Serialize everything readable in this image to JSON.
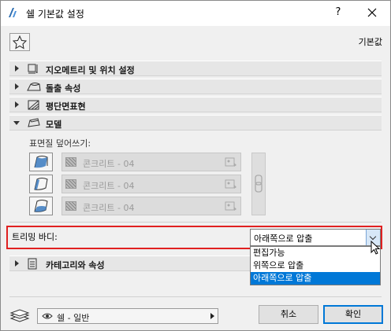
{
  "window": {
    "title": "쉘 기본값 설정",
    "help_label": "?"
  },
  "header": {
    "default_label": "기본값"
  },
  "sections": [
    {
      "label": "지오메트리 및 위치 설정",
      "icon": "geometry-icon",
      "expanded": false
    },
    {
      "label": "돌출 속성",
      "icon": "extrusion-icon",
      "expanded": false
    },
    {
      "label": "평단면표현",
      "icon": "floorplan-icon",
      "expanded": false
    },
    {
      "label": "모델",
      "icon": "model-icon",
      "expanded": true
    }
  ],
  "model": {
    "override_label": "표면질 덮어쓰기:",
    "surfaces": [
      {
        "value": "콘크리트 - 04",
        "icon": "surface-top-icon"
      },
      {
        "value": "콘크리트 - 04",
        "icon": "surface-side-icon"
      },
      {
        "value": "콘크리트 - 04",
        "icon": "surface-bottom-icon"
      }
    ]
  },
  "trim": {
    "label": "트리밍 바디:",
    "selected": "아래쪽으로 압출",
    "options": [
      "편집가능",
      "위쪽으로 압출",
      "아래쪽으로 압출"
    ],
    "highlighted_index": 2
  },
  "category": {
    "label": "카테고리와 속성",
    "icon": "category-icon"
  },
  "footer": {
    "layer_value": "쉘 - 일반",
    "cancel_label": "취소",
    "ok_label": "확인"
  },
  "colors": {
    "highlight": "#0078d7",
    "annotation_box": "#e02020"
  }
}
